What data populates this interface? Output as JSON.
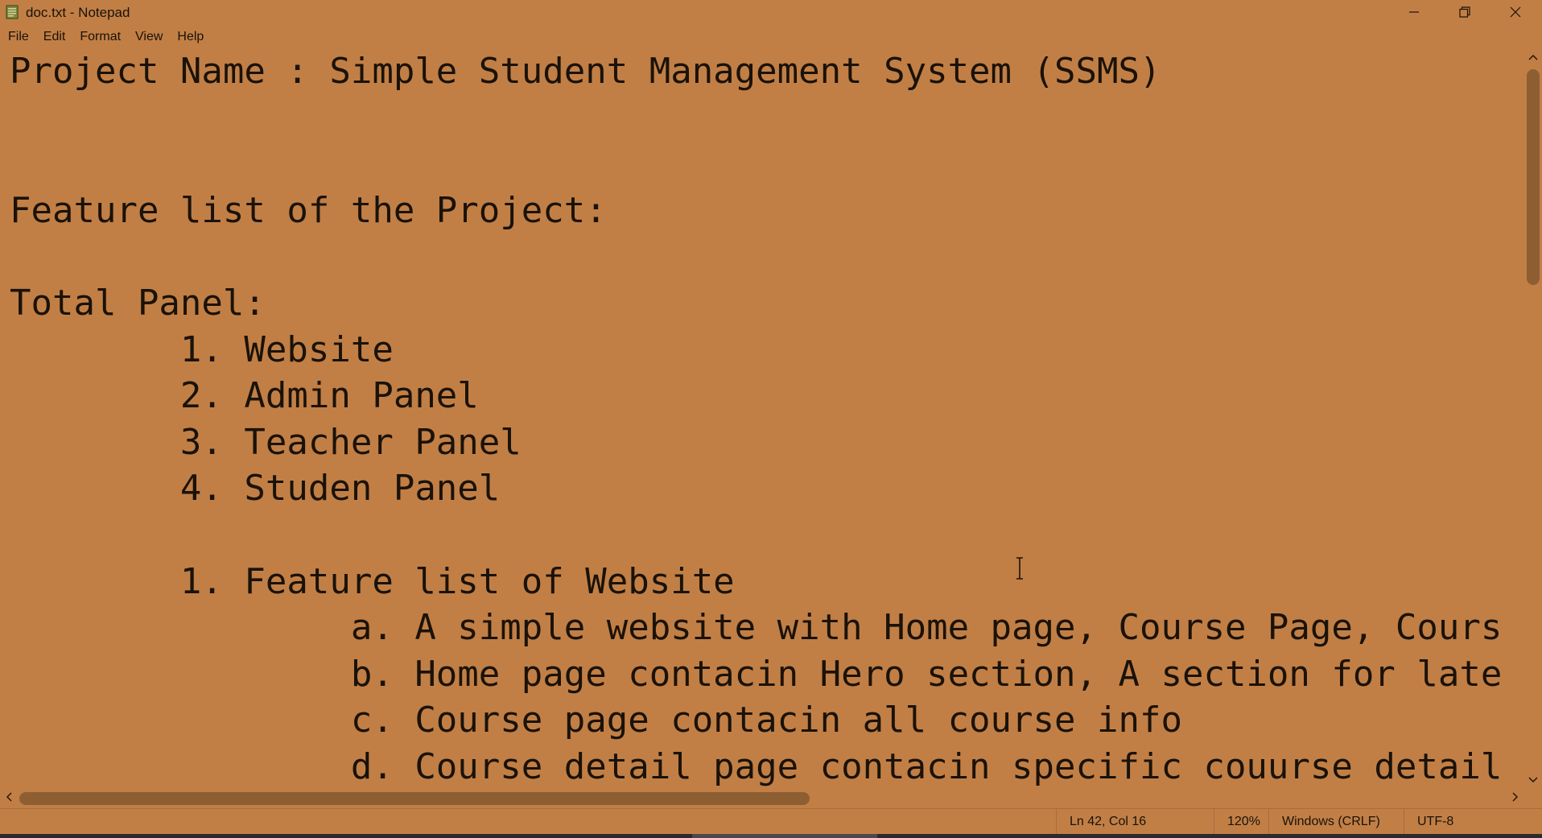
{
  "window": {
    "title": "doc.txt - Notepad",
    "icon": "notepad-icon",
    "controls": [
      "minimize-icon",
      "restore-icon",
      "close-icon"
    ]
  },
  "menu": {
    "items": [
      {
        "label": "File"
      },
      {
        "label": "Edit"
      },
      {
        "label": "Format"
      },
      {
        "label": "View"
      },
      {
        "label": "Help"
      }
    ]
  },
  "editor": {
    "content": "Project Name : Simple Student Management System (SSMS)\n\n\nFeature list of the Project:\n\nTotal Panel:\n        1. Website\n        2. Admin Panel\n        3. Teacher Panel\n        4. Studen Panel\n\n        1. Feature list of Website\n                a. A simple website with Home page, Course Page, Cours\n                b. Home page contacin Hero section, A section for late\n                c. Course page contacin all course info\n                d. Course detail page contacin specific couurse detail"
  },
  "status": {
    "position": "Ln 42, Col 16",
    "zoom": "120%",
    "line_ending": "Windows (CRLF)",
    "encoding": "UTF-8"
  },
  "colors": {
    "background": "#c17f46",
    "text": "#1a1208",
    "scroll_thumb": "#8e5e33"
  }
}
